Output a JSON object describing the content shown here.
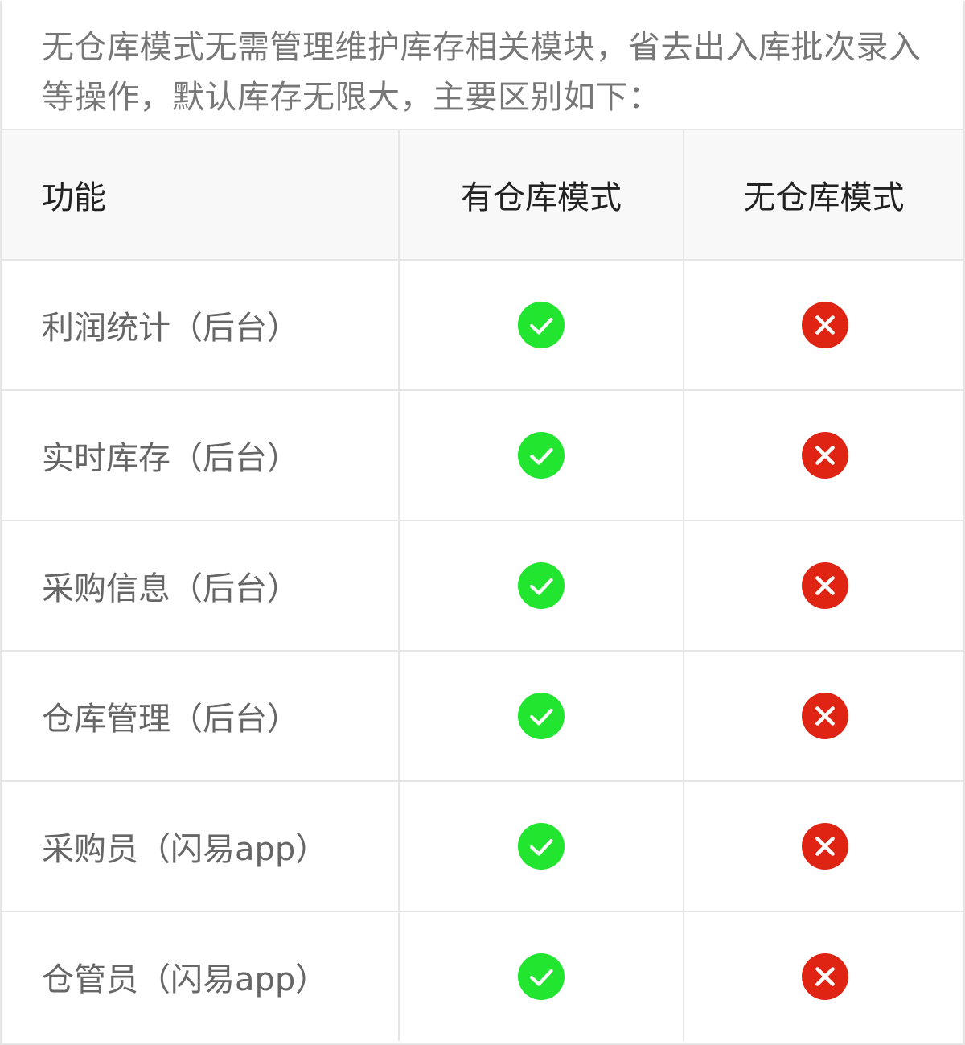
{
  "intro": {
    "text": "无仓库模式无需管理维护库存相关模块，省去出入库批次录入等操作，默认库存无限大，主要区别如下："
  },
  "table": {
    "headers": [
      "功能",
      "有仓库模式",
      "无仓库模式"
    ],
    "rows": [
      {
        "feature": "利润统计（后台）",
        "with_warehouse": "check-icon",
        "without_warehouse": "cross-icon"
      },
      {
        "feature": "实时库存（后台）",
        "with_warehouse": "check-icon",
        "without_warehouse": "cross-icon"
      },
      {
        "feature": "采购信息（后台）",
        "with_warehouse": "check-icon",
        "without_warehouse": "cross-icon"
      },
      {
        "feature": "仓库管理（后台）",
        "with_warehouse": "check-icon",
        "without_warehouse": "cross-icon"
      },
      {
        "feature": "采购员（闪易app）",
        "with_warehouse": "check-icon",
        "without_warehouse": "cross-icon"
      },
      {
        "feature": "仓管员（闪易app）",
        "with_warehouse": "check-icon",
        "without_warehouse": "cross-icon"
      }
    ]
  },
  "colors": {
    "check": "#22e530",
    "cross": "#e02414",
    "header_bg": "#f8f8f8",
    "border": "#e6e6e6"
  }
}
